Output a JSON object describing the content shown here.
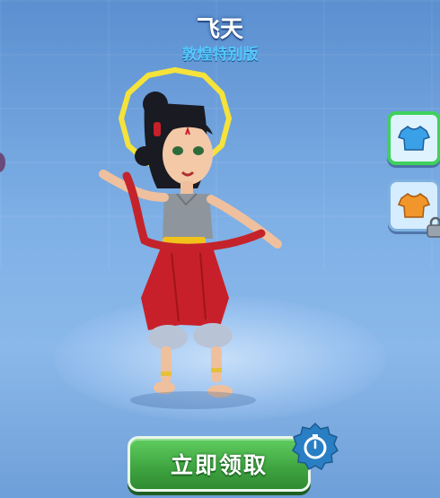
{
  "character": {
    "name": "飞天",
    "edition": "敦煌特别版"
  },
  "outfits": [
    {
      "icon": "shirt-icon",
      "color": "#3aa0e8",
      "state": "selected",
      "accent": "#3ed15c"
    },
    {
      "icon": "shirt-icon",
      "color": "#f0962a",
      "state": "locked"
    }
  ],
  "claim_button": {
    "label": "立即领取",
    "icon": "stopwatch-icon",
    "color": "#3ea33f"
  },
  "colors": {
    "title": "#ffffff",
    "subtitle": "#55c8ff",
    "background": "#7fb0e6"
  }
}
